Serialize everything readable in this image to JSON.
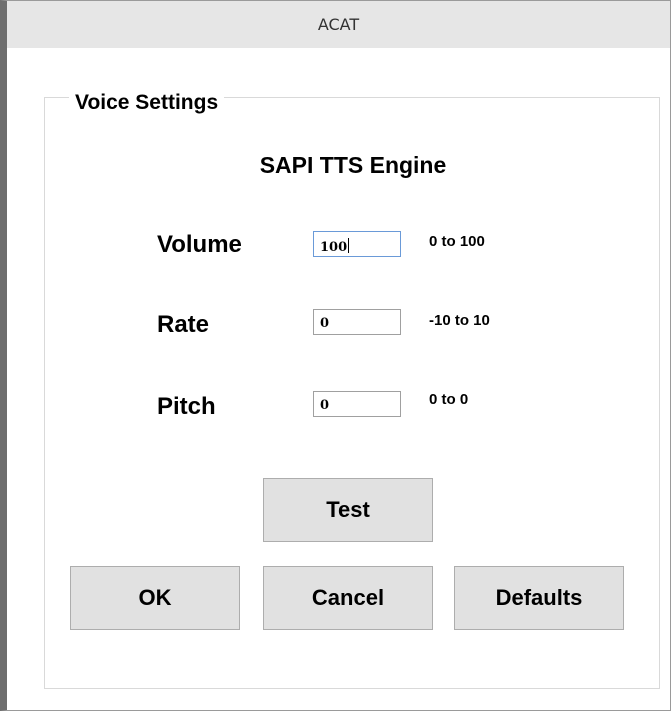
{
  "window": {
    "title": "ACAT"
  },
  "group": {
    "title": "Voice Settings",
    "engine": "SAPI TTS Engine"
  },
  "fields": {
    "volume": {
      "label": "Volume",
      "value": "100",
      "range": "0 to 100"
    },
    "rate": {
      "label": "Rate",
      "value": "0",
      "range": "-10 to 10"
    },
    "pitch": {
      "label": "Pitch",
      "value": "0",
      "range": "0 to 0"
    }
  },
  "buttons": {
    "test": "Test",
    "ok": "OK",
    "cancel": "Cancel",
    "defaults": "Defaults"
  }
}
